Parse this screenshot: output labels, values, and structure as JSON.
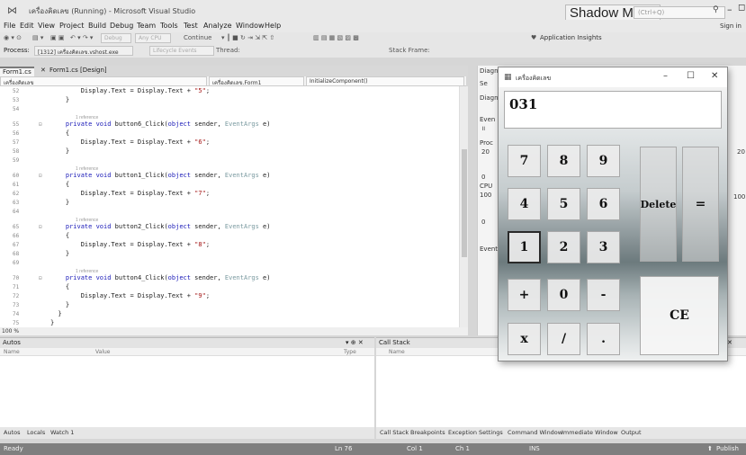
{
  "window": {
    "title": "เครื่องคิดเลข (Running) - Microsoft Visual Studio",
    "shadow_mode": "Shadow Mode",
    "quick_launch_placeholder": "(Ctrl+Q)",
    "sign_in": "Sign in"
  },
  "menu": [
    "File",
    "Edit",
    "View",
    "Project",
    "Build",
    "Debug",
    "Team",
    "Tools",
    "Test",
    "Analyze",
    "Window",
    "Help"
  ],
  "toolbar": {
    "debug": "Debug",
    "cpu": "Any CPU",
    "continue": "Continue",
    "app_insights": "Application Insights"
  },
  "processbar": {
    "process_label": "Process:",
    "process_value": "[1312] เครื่องคิดเลข.vshost.exe",
    "lifecycle": "Lifecycle Events",
    "thread": "Thread:",
    "stack_frame": "Stack Frame:"
  },
  "editor": {
    "tabs": [
      "Form1.cs",
      "Form1.cs [Design]"
    ],
    "nav_project": "เครื่องคิดเลข",
    "nav_class": "เครื่องคิดเลข.Form1",
    "nav_member": "InitializeComponent()",
    "zoom": "100 %",
    "lines": [
      {
        "n": "52",
        "code": "        Display.Text = Display.Text + \"5\";"
      },
      {
        "n": "53",
        "code": "    }"
      },
      {
        "n": "54",
        "code": ""
      },
      {
        "n": "55",
        "code": "    private void button6_Click(object sender, EventArgs e)",
        "ref": "1 reference"
      },
      {
        "n": "56",
        "code": "    {"
      },
      {
        "n": "57",
        "code": "        Display.Text = Display.Text + \"6\";"
      },
      {
        "n": "58",
        "code": "    }"
      },
      {
        "n": "59",
        "code": ""
      },
      {
        "n": "60",
        "code": "    private void button1_Click(object sender, EventArgs e)",
        "ref": "1 reference"
      },
      {
        "n": "61",
        "code": "    {"
      },
      {
        "n": "62",
        "code": "        Display.Text = Display.Text + \"7\";"
      },
      {
        "n": "63",
        "code": "    }"
      },
      {
        "n": "64",
        "code": ""
      },
      {
        "n": "65",
        "code": "    private void button2_Click(object sender, EventArgs e)",
        "ref": "1 reference"
      },
      {
        "n": "66",
        "code": "    {"
      },
      {
        "n": "67",
        "code": "        Display.Text = Display.Text + \"8\";"
      },
      {
        "n": "68",
        "code": "    }"
      },
      {
        "n": "69",
        "code": ""
      },
      {
        "n": "70",
        "code": "    private void button4_Click(object sender, EventArgs e)",
        "ref": "1 reference"
      },
      {
        "n": "71",
        "code": "    {"
      },
      {
        "n": "72",
        "code": "        Display.Text = Display.Text + \"9\";"
      },
      {
        "n": "73",
        "code": "    }"
      },
      {
        "n": "74",
        "code": "  }"
      },
      {
        "n": "75",
        "code": "}"
      },
      {
        "n": "76",
        "code": ""
      }
    ]
  },
  "diagnostics": {
    "title": "Diagno",
    "session": "Se",
    "label_diag": "Diagn",
    "events": "Even",
    "process": "Proc",
    "cpu": "CPU",
    "v20": "20",
    "v0": "0",
    "v100": "100",
    "v0b": "0",
    "events_tab": "Events",
    "right_20": "20",
    "right_100": "100"
  },
  "autos": {
    "title": "Autos",
    "col_name": "Name",
    "col_value": "Value",
    "col_type": "Type",
    "tabs": [
      "Autos",
      "Locals",
      "Watch 1"
    ]
  },
  "callstack": {
    "title": "Call Stack",
    "col_name": "Name",
    "tabs": [
      "Call Stack",
      "Breakpoints",
      "Exception Settings",
      "Command Window",
      "Immediate Window",
      "Output"
    ]
  },
  "status": {
    "ready": "Ready",
    "ln": "Ln 76",
    "col": "Col 1",
    "ch": "Ch 1",
    "ins": "INS",
    "publish": "Publish"
  },
  "calculator": {
    "title": "เครื่องคิดเลข",
    "display": "031",
    "buttons": {
      "b7": "7",
      "b8": "8",
      "b9": "9",
      "b4": "4",
      "b5": "5",
      "b6": "6",
      "b1": "1",
      "b2": "2",
      "b3": "3",
      "plus": "+",
      "b0": "0",
      "minus": "-",
      "mult": "x",
      "div": "/",
      "dot": ".",
      "delete": "Delete",
      "equals": "=",
      "ce": "CE"
    }
  }
}
